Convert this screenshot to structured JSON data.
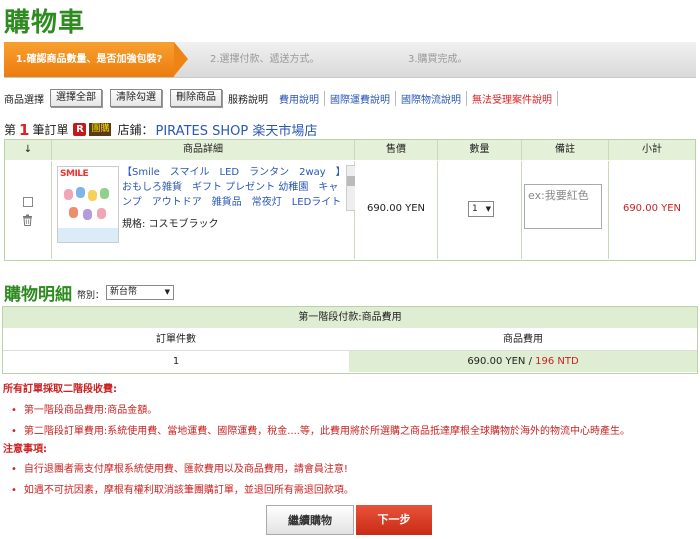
{
  "page_title": "購物車",
  "steps": [
    {
      "label": "1.確認商品數量、是否加強包裝?"
    },
    {
      "label": "2.選擇付款、遞送方式。"
    },
    {
      "label": "3.購買完成。"
    }
  ],
  "toolbar": {
    "product_select_label": "商品選擇",
    "select_all": "選擇全部",
    "clear_all": "清除勾選",
    "delete": "刪除商品",
    "service_label": "服務說明",
    "links": [
      "費用說明",
      "國際運費說明",
      "國際物流說明",
      "無法受理案件說明"
    ]
  },
  "order": {
    "prefix": "第",
    "number": "1",
    "suffix": "筆訂單",
    "badge_r": "R",
    "badge_group": "團購",
    "shop_label": "店鋪：",
    "shop_name": "PIRATES SHOP 楽天市場店"
  },
  "product_table": {
    "headers": [
      "↓",
      "商品詳細",
      "售價",
      "數量",
      "備註",
      "小計"
    ],
    "item": {
      "image_text": "SMILE",
      "name": "【Smile　スマイル　LED　ランタン　2way　】おもしろ雑貨　ギフト プレゼント 幼稚園　キャンプ　アウトドア　雑貨品　常夜灯　LEDライト",
      "spec": "規格: コスモブラック",
      "price": "690.00 YEN",
      "qty": "1",
      "note_placeholder": "ex:我要紅色",
      "subtotal": "690.00 YEN"
    }
  },
  "summary": {
    "title": "購物明細",
    "currency_label": "幣別：",
    "currency": "新台幣",
    "stage_title": "第一階段付款:商品費用",
    "col_count": "訂單件數",
    "col_fee": "商品費用",
    "count": "1",
    "fee_yen": "690.00 YEN /",
    "fee_ntd": "196 NTD"
  },
  "notes": {
    "fee_title": "所有訂單採取二階段收費:",
    "fee_items": [
      "第一階段商品費用:商品金額。",
      "第二階段訂單費用:系統使用費、當地運費、國際運費，稅金....等，此費用將於所選購之商品抵達摩根全球購物於海外的物流中心時產生。"
    ],
    "attention_title": "注意事項:",
    "attention_items": [
      "自行退團者需支付摩根系統使用費、匯款費用以及商品費用，請會員注意!",
      "如遇不可抗因素，摩根有權利取消該筆團購訂單，並退回所有需退回款項。"
    ]
  },
  "buttons": {
    "continue": "繼續購物",
    "next": "下一步"
  }
}
